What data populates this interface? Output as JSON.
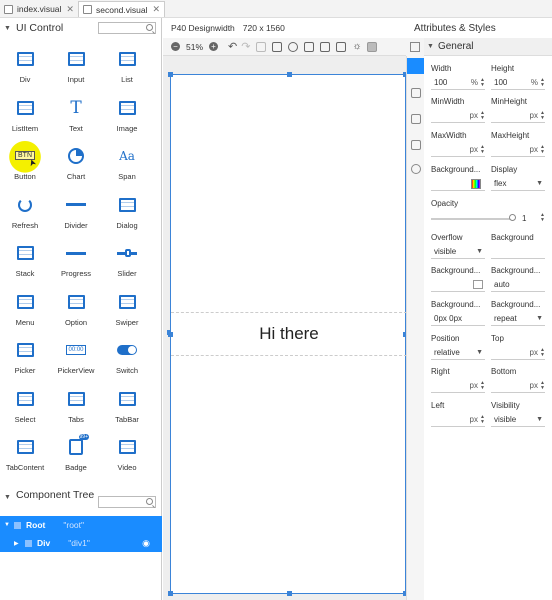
{
  "tabs": [
    {
      "label": "index.visual"
    },
    {
      "label": "second.visual"
    }
  ],
  "ui_control": {
    "title": "UI Control",
    "items": [
      {
        "label": "Div",
        "icon": "div-icon"
      },
      {
        "label": "Input",
        "icon": "input-icon"
      },
      {
        "label": "List",
        "icon": "list-icon"
      },
      {
        "label": "ListItem",
        "icon": "listitem-icon"
      },
      {
        "label": "Text",
        "icon": "text-icon"
      },
      {
        "label": "Image",
        "icon": "image-icon"
      },
      {
        "label": "Button",
        "icon": "button-icon"
      },
      {
        "label": "Chart",
        "icon": "chart-icon"
      },
      {
        "label": "Span",
        "icon": "span-icon"
      },
      {
        "label": "Refresh",
        "icon": "refresh-icon"
      },
      {
        "label": "Divider",
        "icon": "divider-icon"
      },
      {
        "label": "Dialog",
        "icon": "dialog-icon"
      },
      {
        "label": "Stack",
        "icon": "stack-icon"
      },
      {
        "label": "Progress",
        "icon": "progress-icon"
      },
      {
        "label": "Slider",
        "icon": "slider-icon"
      },
      {
        "label": "Menu",
        "icon": "menu-icon"
      },
      {
        "label": "Option",
        "icon": "option-icon"
      },
      {
        "label": "Swiper",
        "icon": "swiper-icon"
      },
      {
        "label": "Picker",
        "icon": "picker-icon"
      },
      {
        "label": "PickerView",
        "icon": "pickerview-icon"
      },
      {
        "label": "Switch",
        "icon": "switch-icon"
      },
      {
        "label": "Select",
        "icon": "select-icon"
      },
      {
        "label": "Tabs",
        "icon": "tabs-icon"
      },
      {
        "label": "TabBar",
        "icon": "tabbar-icon"
      },
      {
        "label": "TabContent",
        "icon": "tabcontent-icon"
      },
      {
        "label": "Badge",
        "icon": "badge-icon"
      },
      {
        "label": "Video",
        "icon": "video-icon"
      }
    ],
    "button_icon_text": "BTN",
    "text_icon_glyph": "T",
    "span_icon_glyph": "Aa",
    "badge_icon_text": "99+",
    "pickerview_icon_text": "00:00"
  },
  "component_tree": {
    "title": "Component Tree",
    "rows": [
      {
        "name": "Root",
        "id": "\"root\""
      },
      {
        "name": "Div",
        "id": "\"div1\""
      }
    ]
  },
  "canvas": {
    "device": "P40 Designwidth",
    "resolution": "720 x 1560",
    "zoom": "51%",
    "text": "Hi there"
  },
  "attributes": {
    "title": "Attributes & Styles",
    "section": "General",
    "width": {
      "label": "Width",
      "value": "100",
      "unit": "%"
    },
    "height": {
      "label": "Height",
      "value": "100",
      "unit": "%"
    },
    "min_width": {
      "label": "MinWidth",
      "unit": "px"
    },
    "min_height": {
      "label": "MinHeight",
      "unit": "px"
    },
    "max_width": {
      "label": "MaxWidth",
      "unit": "px"
    },
    "max_height": {
      "label": "MaxHeight",
      "unit": "px"
    },
    "background_color": {
      "label": "Background..."
    },
    "display": {
      "label": "Display",
      "value": "flex"
    },
    "opacity": {
      "label": "Opacity",
      "value": "1",
      "level": 1
    },
    "overflow": {
      "label": "Overflow",
      "value": "visible"
    },
    "background": {
      "label": "Background"
    },
    "background_image": {
      "label": "Background..."
    },
    "background_size": {
      "label": "Background...",
      "value": "auto"
    },
    "background_position": {
      "label": "Background...",
      "value": "0px 0px"
    },
    "background_repeat": {
      "label": "Background...",
      "value": "repeat"
    },
    "position": {
      "label": "Position",
      "value": "relative"
    },
    "top": {
      "label": "Top",
      "unit": "px"
    },
    "right": {
      "label": "Right",
      "unit": "px"
    },
    "bottom": {
      "label": "Bottom",
      "unit": "px"
    },
    "left": {
      "label": "Left",
      "unit": "px"
    },
    "visibility": {
      "label": "Visibility",
      "value": "visible"
    }
  }
}
